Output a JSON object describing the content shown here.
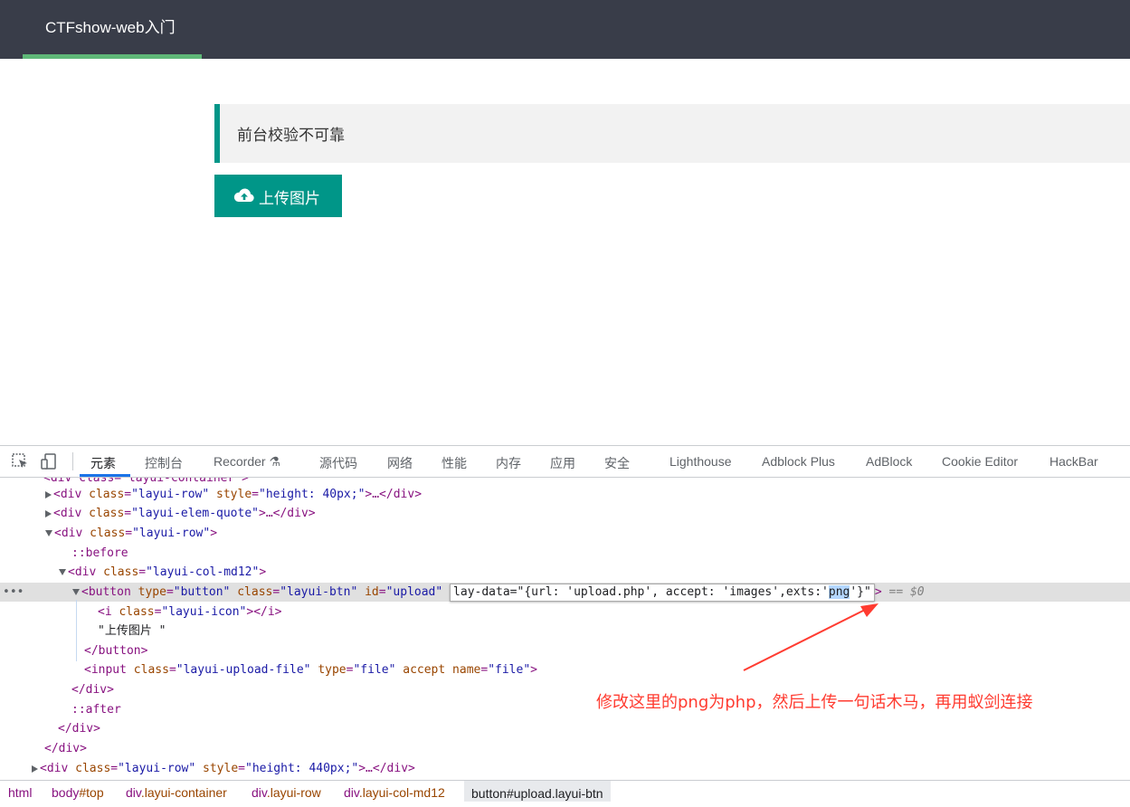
{
  "app": {
    "title": "CTFshow-web入门"
  },
  "main": {
    "quote": "前台校验不可靠",
    "upload_button": "上传图片"
  },
  "devtools": {
    "tabs": [
      "元素",
      "控制台",
      "Recorder",
      "源代码",
      "网络",
      "性能",
      "内存",
      "应用",
      "安全",
      "Lighthouse",
      "Adblock Plus",
      "AdBlock",
      "Cookie Editor",
      "HackBar"
    ],
    "active_tab": "元素",
    "code": {
      "l1": "<div class=\"layui-container\">",
      "l2_tag": "<div ",
      "l2_attr": "class",
      "l2_val": "\"layui-row\"",
      "l2_attr2": "style",
      "l2_val2": "\"height: 40px;\"",
      "l2_end": ">…</div>",
      "l3_tag": "<div ",
      "l3_attr": "class",
      "l3_val": "\"layui-elem-quote\"",
      "l3_end": ">…</div>",
      "l4_tag": "<div ",
      "l4_attr": "class",
      "l4_val": "\"layui-row\"",
      "l4_end": ">",
      "l5": "::before",
      "l6_tag": "<div ",
      "l6_attr": "class",
      "l6_val": "\"layui-col-md12\"",
      "l6_end": ">",
      "l7_tag": "<button ",
      "l7_attr1": "type",
      "l7_val1": "\"button\"",
      "l7_attr2": "class",
      "l7_val2": "\"layui-btn\"",
      "l7_attr3": "id",
      "l7_val3": "\"upload\"",
      "l7_edit_before": "lay-data=\"{url: 'upload.php', accept: 'images',exts:'",
      "l7_edit_hl": "png",
      "l7_edit_after": "'}\"",
      "l7_end": ">",
      "l7_dollar": " == $0",
      "l8_tag": "<i ",
      "l8_attr": "class",
      "l8_val": "\"layui-icon\"",
      "l8_end": ">",
      "l8_glyph": "",
      "l8_close": "</i>",
      "l9": "\"上传图片 \"",
      "l10": "</button>",
      "l11_tag": "<input ",
      "l11_attr1": "class",
      "l11_val1": "\"layui-upload-file\"",
      "l11_attr2": "type",
      "l11_val2": "\"file\"",
      "l11_attr3": "accept",
      "l11_attr4": "name",
      "l11_val4": "\"file\"",
      "l11_end": ">",
      "l12": "</div>",
      "l13": "::after",
      "l14": "</div>",
      "l15": "</div>",
      "l16_tag": "<div ",
      "l16_attr": "class",
      "l16_val": "\"layui-row\"",
      "l16_attr2": "style",
      "l16_val2": "\"height: 440px;\"",
      "l16_end": ">…</div>"
    },
    "breadcrumbs": [
      {
        "tag": "html",
        "rest": ""
      },
      {
        "tag": "body",
        "rest": "#top"
      },
      {
        "tag": "div",
        "rest": ".layui-container"
      },
      {
        "tag": "div",
        "rest": ".layui-row"
      },
      {
        "tag": "div",
        "rest": ".layui-col-md12"
      },
      {
        "tag": "button",
        "rest": "#upload.layui-btn"
      }
    ]
  },
  "annotation": "修改这里的png为php，然后上传一句话木马，再用蚁剑连接",
  "colors": {
    "topbar": "#393d49",
    "accent": "#009688",
    "nav_underline": "#5fb878",
    "annotation": "#ff3b30"
  }
}
